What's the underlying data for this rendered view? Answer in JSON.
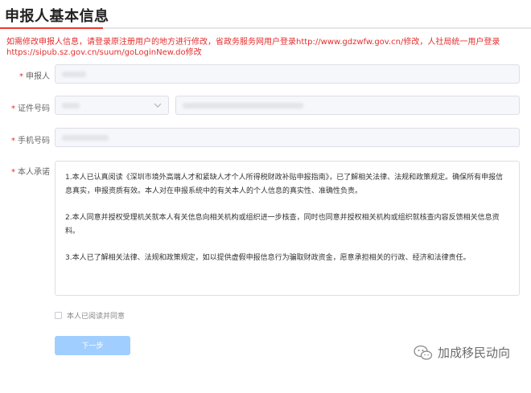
{
  "page": {
    "title": "申报人基本信息",
    "notice": "如需修改申报人信息，请登录原注册用户的地方进行修改，省政务服务网用户登录http://www.gdzwfw.gov.cn/修改，人社局统一用户登录https://sipub.sz.gov.cn/suum/goLoginNew.do修改"
  },
  "form": {
    "applicant": {
      "label": "申报人",
      "required_mark": "*"
    },
    "id_number": {
      "label": "证件号码",
      "required_mark": "*"
    },
    "phone": {
      "label": "手机号码",
      "required_mark": "*"
    },
    "commitment": {
      "label": "本人承诺",
      "required_mark": "*",
      "paragraphs": [
        "1.本人已认真阅读《深圳市境外高端人才和紧缺人才个人所得税财政补贴申报指南》，已了解相关法律、法规和政策规定。确保所有申报信息真实，申报资质有效。本人对在申报系统中的有关本人的个人信息的真实性、准确性负责。",
        "2.本人同意并授权受理机关就本人有关信息向相关机构或组织进一步核查，同时也同意并授权相关机构或组织就核查内容反馈相关信息资料。",
        "3.本人已了解相关法律、法规和政策规定，如以提供虚假申报信息行为骗取财政资金，愿意承担相关的行政、经济和法律责任。"
      ]
    },
    "agree_label": "本人已阅读并同意",
    "next_button": "下一步"
  },
  "watermark": {
    "text": "加成移民动向",
    "icon": "wechat-icon"
  },
  "colors": {
    "accent": "#e93a2f",
    "notice": "#e52d2d",
    "button": "#a0cfff"
  }
}
